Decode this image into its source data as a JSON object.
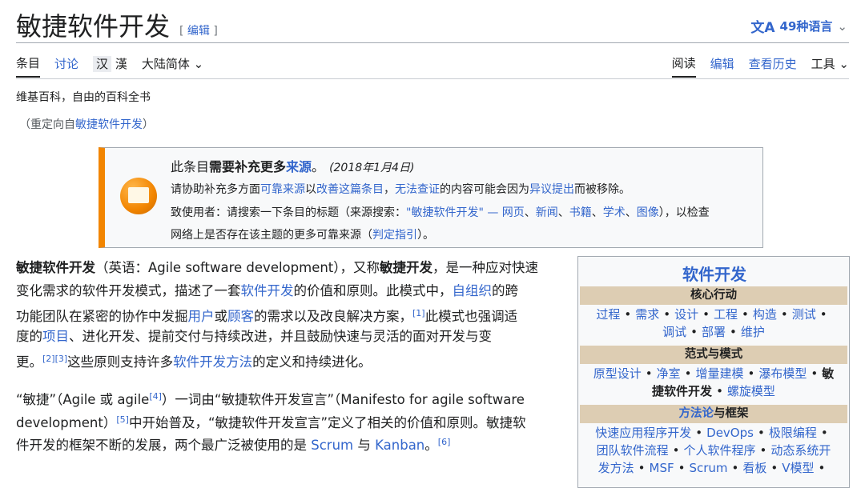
{
  "header": {
    "title": "敏捷软件开发",
    "edit": "编辑",
    "languages": "49种语言"
  },
  "tabs_left": {
    "article": "条目",
    "talk": "讨论",
    "han1": "汉",
    "han2": "漢",
    "variant": "大陆简体"
  },
  "tabs_right": {
    "read": "阅读",
    "edit": "编辑",
    "history": "查看历史",
    "tools": "工具"
  },
  "site_sub": "维基百科，自由的百科全书",
  "redirect": {
    "prefix": "（重定向自",
    "link": "敏捷软件开发",
    "suffix": "）"
  },
  "ambox": {
    "l1_a": "此条目",
    "l1_b": "需要补充更多",
    "l1_c": "来源",
    "l1_d": "。",
    "date": "(2018年1月4日)",
    "l2_a": "请协助补充多方面",
    "l2_b": "可靠来源",
    "l2_c": "以",
    "l2_d": "改善这篇条目",
    "l2_e": "，",
    "l2_f": "无法查证",
    "l2_g": "的内容可能会因为",
    "l2_h": "异议提出",
    "l2_i": "而被移除。",
    "l3_a": "致使用者：请搜索一下条目的标题（来源搜索：",
    "l3_b": "\"敏捷软件开发\" — 网页",
    "l3_c": "、",
    "l3_d": "新闻",
    "l3_e": "、",
    "l3_f": "书籍",
    "l3_g": "、",
    "l3_h": "学术",
    "l3_i": "、",
    "l3_j": "图像",
    "l3_k": "），以检查",
    "l4_a": "网络上是否存在该主题的更多可靠来源（",
    "l4_b": "判定指引",
    "l4_c": "）。"
  },
  "para1": {
    "l1_a": "敏捷软件开发",
    "l1_b": "（英语：Agile software development），又称",
    "l1_c": "敏捷开发",
    "l1_d": "，是一种应对快速",
    "l2_a": "变化需求的软件开发模式，描述了一套",
    "l2_b": "软件开发",
    "l2_c": "的价值和原则。此模式中，",
    "l2_d": "自组织",
    "l2_e": "的跨",
    "l3_a": "功能团队在紧密的协作中发掘",
    "l3_b": "用户",
    "l3_c": "或",
    "l3_d": "顾客",
    "l3_e": "的需求以及改良解决方案，",
    "l3_sup": "[1]",
    "l3_f": "此模式也强调适",
    "l4_a": "度的",
    "l4_b": "项目",
    "l4_c": "、进化开发、提前交付与持续改进，并且鼓励快速与灵活的面对开发与变",
    "l5_a": "更。",
    "l5_sup": "[2][3]",
    "l5_b": "这些原则支持许多",
    "l5_c": "软件开发方法",
    "l5_d": "的定义和持续进化。"
  },
  "para2": {
    "l1_a": "“敏捷”（Agile 或 agile",
    "l1_sup": "[4]",
    "l1_b": "）一词由“敏捷软件开发宣言”（Manifesto for agile software",
    "l2_a": "development）",
    "l2_sup": "[5]",
    "l2_b": "中开始普及，“敏捷软件开发宣言”定义了相关的价值和原则。敏捷软",
    "l3_a": "件开发的框架不断的发展，两个最广泛被使用的是 ",
    "l3_b": "Scrum",
    "l3_c": " 与 ",
    "l3_d": "Kanban",
    "l3_e": "。",
    "l3_sup": "[6]"
  },
  "infobox": {
    "title": "软件开发",
    "h1": "核心行动",
    "core1": [
      "过程",
      "需求",
      "设计",
      "工程",
      "构造",
      "测试"
    ],
    "core2": [
      "调试",
      "部署",
      "维护"
    ],
    "h2": "范式与模式",
    "para1": [
      "原型设计",
      "净室",
      "增量建模",
      "瀑布模型"
    ],
    "para1_end": "敏",
    "para2_a": "捷软件开发",
    "para2_b": "螺旋模型",
    "h3_a": "方法论",
    "h3_b": "与框架",
    "m1": [
      "快速应用程序开发",
      "DevOps",
      "极限编程"
    ],
    "m2": [
      "团队软件流程",
      "个人软件程序",
      "动态系统开"
    ],
    "m3": [
      "发方法",
      "MSF",
      "Scrum",
      "看板",
      "V模型"
    ]
  },
  "colors": {
    "link": "#3366cc",
    "accent": "#f28500",
    "infobox_header": "#ddcdb3"
  }
}
